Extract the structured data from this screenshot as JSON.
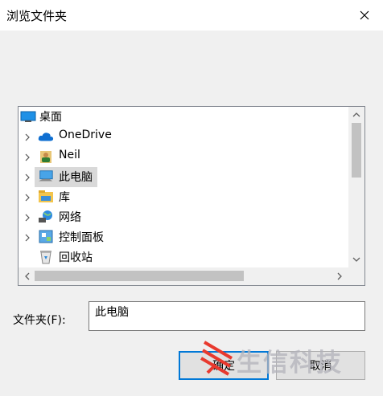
{
  "window": {
    "title": "浏览文件夹"
  },
  "tree": {
    "items": [
      {
        "label": "桌面",
        "icon": "desktop-icon",
        "expandable": false
      },
      {
        "label": "OneDrive",
        "icon": "cloud-icon",
        "expandable": true
      },
      {
        "label": "Neil",
        "icon": "user-folder-icon",
        "expandable": true
      },
      {
        "label": "此电脑",
        "icon": "computer-icon",
        "expandable": true,
        "selected": true
      },
      {
        "label": "库",
        "icon": "library-icon",
        "expandable": true
      },
      {
        "label": "网络",
        "icon": "network-icon",
        "expandable": true
      },
      {
        "label": "控制面板",
        "icon": "control-panel-icon",
        "expandable": true
      },
      {
        "label": "回收站",
        "icon": "recycle-bin-icon",
        "expandable": false
      }
    ]
  },
  "folder_field": {
    "label": "文件夹(F):",
    "value": "此电脑"
  },
  "buttons": {
    "ok": "确定",
    "cancel": "取消"
  },
  "watermark": {
    "text": "生信科技"
  },
  "colors": {
    "accent": "#0078d7",
    "selected": "#d9d9d9",
    "logo": "#e8392e"
  }
}
